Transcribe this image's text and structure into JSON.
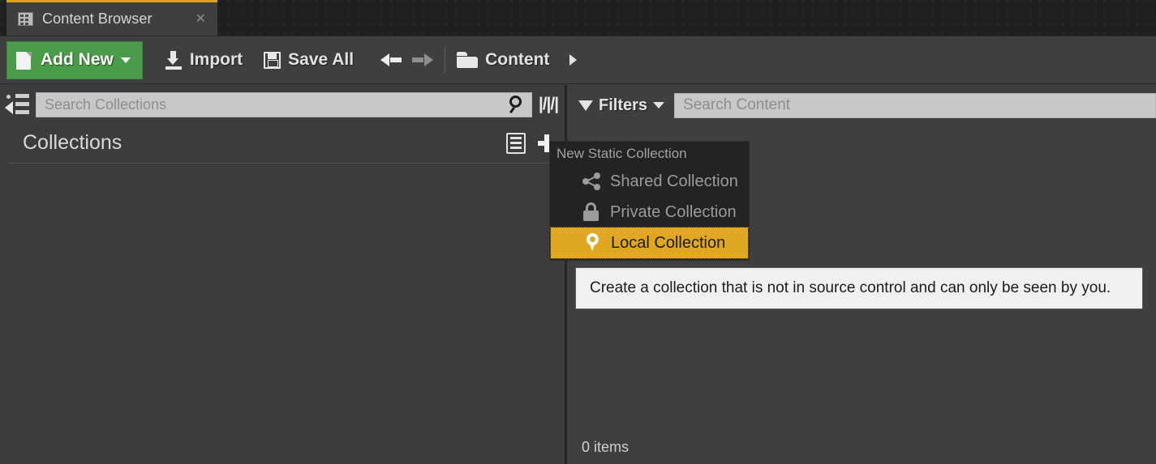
{
  "tab": {
    "icon": "content-browser-icon",
    "label": "Content Browser",
    "close_glyph": "✕",
    "accent_color": "#d9a41f"
  },
  "toolbar": {
    "add_new_label": "Add New",
    "add_new_color": "#4a9b4a",
    "import_label": "Import",
    "save_all_label": "Save All",
    "back_icon": "arrow-left-icon",
    "forward_icon": "arrow-right-icon",
    "folder_icon": "folder-icon",
    "breadcrumb_label": "Content",
    "breadcrumb_caret": "caret-right-icon"
  },
  "collections_panel": {
    "tree_icon": "collapse-tree-icon",
    "search": {
      "placeholder": "Search Collections",
      "value": "",
      "icon": "magnifier-icon"
    },
    "splitter_icon": "|/|/|",
    "title": "Collections",
    "view_options_icon": "view-options-icon",
    "add_icon": "plus-icon"
  },
  "content_panel": {
    "filters_label": "Filters",
    "filter_icon": "funnel-icon",
    "search": {
      "placeholder": "Search Content",
      "value": ""
    },
    "items_count": "0 items"
  },
  "menu": {
    "header": "New Static Collection",
    "highlight_color": "#e0a820",
    "items": [
      {
        "label": "Shared Collection",
        "icon": "share-icon",
        "highlighted": false
      },
      {
        "label": "Private Collection",
        "icon": "lock-icon",
        "highlighted": false
      },
      {
        "label": "Local Collection",
        "icon": "map-pin-icon",
        "highlighted": true
      }
    ]
  },
  "tooltip": {
    "text": "Create a collection that is not in source control and can only be seen by you."
  }
}
